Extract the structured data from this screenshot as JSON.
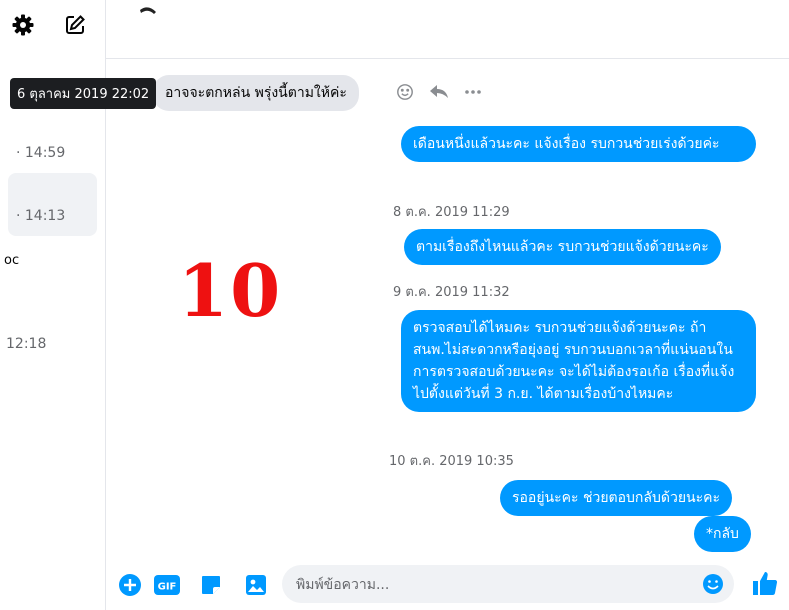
{
  "sidebar": {
    "times": [
      "· 14:59",
      "· 14:13",
      "12:18"
    ],
    "fragment": "oc"
  },
  "tooltip": "6 ตุลาคม 2019 22:02",
  "incoming": {
    "text": "อาจจะตกหล่น พรุ่งนี้ตามให้ค่ะ"
  },
  "messages": {
    "m1": "เดือนหนึ่งแล้วนะคะ แจ้งเรื่อง รบกวนช่วยเร่งด้วยค่ะ",
    "t1": "8 ต.ค. 2019 11:29",
    "m2": "ตามเรื่องถึงไหนแล้วคะ รบกวนช่วยแจ้งด้วยนะคะ",
    "t2": "9 ต.ค. 2019 11:32",
    "m3": "ตรวจสอบได้ไหมคะ รบกวนช่วยแจ้งด้วยนะคะ ถ้าสนพ.ไม่สะดวกหรือยุ่งอยู่ รบกวนบอกเวลาที่แน่นอนในการตรวจสอบด้วยนะคะ จะได้ไม่ต้องรอเก้อ เรื่องที่แจ้งไปตั้งแต่วันที่ 3 ก.ย. ได้ตามเรื่องบ้างไหมคะ",
    "t3": "10 ต.ค. 2019 10:35",
    "m4": "รออยู่นะคะ ช่วยตอบกลับด้วยนะคะ",
    "m5": "*กลับ"
  },
  "overlay_number": "10",
  "composer": {
    "placeholder": "พิมพ์ข้อความ...",
    "gif_label": "GIF"
  },
  "colors": {
    "accent": "#0099ff",
    "overlay": "#ee1111"
  },
  "icons": [
    "gear-icon",
    "compose-icon",
    "emoji-icon",
    "reply-icon",
    "more-icon",
    "plus-icon",
    "gif-icon",
    "sticker-icon",
    "image-icon",
    "like-icon"
  ]
}
